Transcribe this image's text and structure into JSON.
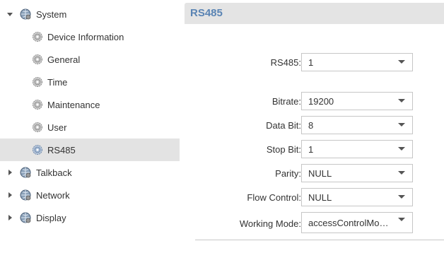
{
  "sidebar": {
    "system": {
      "label": "System"
    },
    "children": [
      {
        "label": "Device Information",
        "icon": "gear-icon"
      },
      {
        "label": "General",
        "icon": "gear-icon"
      },
      {
        "label": "Time",
        "icon": "gear-icon"
      },
      {
        "label": "Maintenance",
        "icon": "gear-icon"
      },
      {
        "label": "User",
        "icon": "gear-icon"
      },
      {
        "label": "RS485",
        "icon": "gear-icon",
        "selected": true
      }
    ],
    "talkback": {
      "label": "Talkback"
    },
    "network": {
      "label": "Network"
    },
    "display": {
      "label": "Display"
    }
  },
  "header": {
    "title": "RS485"
  },
  "form": {
    "rs485": {
      "label": "RS485:",
      "value": "1"
    },
    "bitrate": {
      "label": "Bitrate:",
      "value": "19200"
    },
    "data_bit": {
      "label": "Data Bit:",
      "value": "8"
    },
    "stop_bit": {
      "label": "Stop Bit:",
      "value": "1"
    },
    "parity": {
      "label": "Parity:",
      "value": "NULL"
    },
    "flow_control": {
      "label": "Flow Control:",
      "value": "NULL"
    },
    "working_mode": {
      "label": "Working Mode:",
      "value": "accessControlMod..."
    }
  },
  "colors": {
    "header_title": "#5a84b4",
    "selected_row": "#e3e3e3",
    "header_bg": "#e4e4e4"
  }
}
